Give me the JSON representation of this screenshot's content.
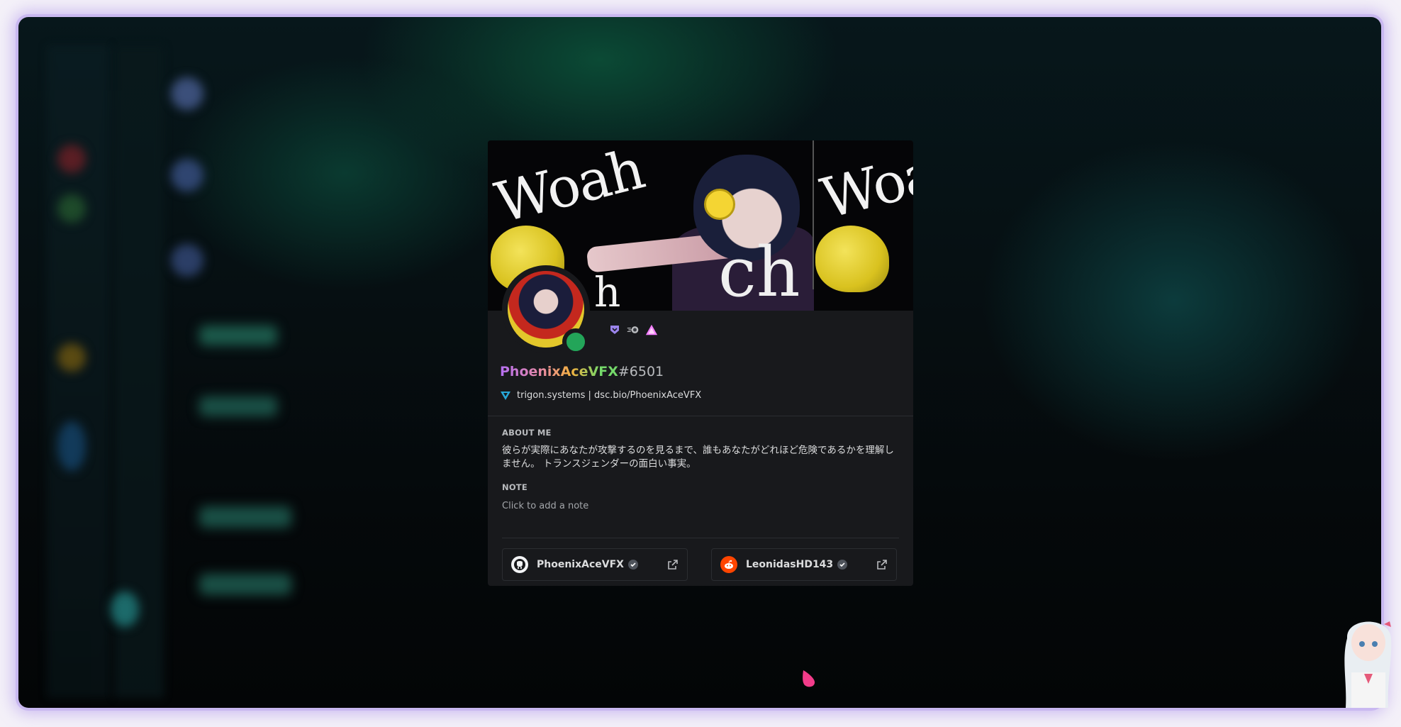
{
  "profile": {
    "username": "PhoenixAceVFX",
    "discriminator": "#6501",
    "custom_status": "trigon.systems | dsc.bio/PhoenixAceVFX",
    "status": "online",
    "badges": [
      "hypesquad-badge",
      "nitro-boost-badge",
      "triangle-badge"
    ],
    "banner_text": [
      "Woah",
      "Woa",
      "ch",
      "h"
    ]
  },
  "about_me": {
    "title": "ABOUT ME",
    "text": "彼らが実際にあなたが攻撃するのを見るまで、誰もあなたがどれほど危険であるかを理解しません。 トランスジェンダーの面白い事実。"
  },
  "note": {
    "title": "NOTE",
    "placeholder": "Click to add a note"
  },
  "connections": [
    {
      "service": "github",
      "name": "PhoenixAceVFX",
      "verified": true
    },
    {
      "service": "reddit",
      "name": "LeonidasHD143",
      "verified": true
    }
  ],
  "colors": {
    "card_bg": "#18191c",
    "online": "#23a559",
    "window_glow": "#c9b8f0",
    "reddit": "#ff4500"
  }
}
